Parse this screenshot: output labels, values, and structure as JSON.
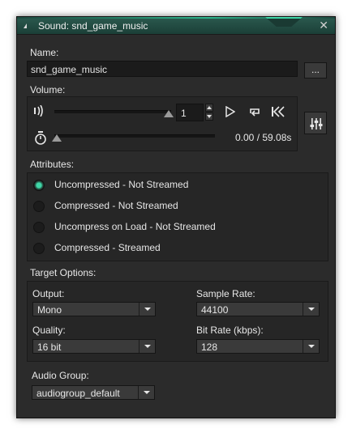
{
  "window": {
    "title": "Sound: snd_game_music",
    "close_glyph": "✕",
    "accent_color": "#3fd6a7"
  },
  "name": {
    "label": "Name:",
    "value": "snd_game_music",
    "browse_label": "..."
  },
  "volume": {
    "label": "Volume:",
    "value": "1",
    "level": 1.0,
    "time_readout": "0.00 / 59.08s",
    "icons": [
      "volume-icon",
      "play-icon",
      "loop-icon",
      "rewind-icon",
      "stopwatch-icon",
      "mixer-icon"
    ]
  },
  "attributes": {
    "label": "Attributes:",
    "options": [
      {
        "label": "Uncompressed - Not Streamed",
        "checked": true
      },
      {
        "label": "Compressed - Not Streamed",
        "checked": false
      },
      {
        "label": "Uncompress on Load - Not Streamed",
        "checked": false
      },
      {
        "label": "Compressed - Streamed",
        "checked": false
      }
    ]
  },
  "target": {
    "label": "Target Options:",
    "output_label": "Output:",
    "output_value": "Mono",
    "sample_rate_label": "Sample Rate:",
    "sample_rate_value": "44100",
    "quality_label": "Quality:",
    "quality_value": "16 bit",
    "bitrate_label": "Bit Rate (kbps):",
    "bitrate_value": "128"
  },
  "audio_group": {
    "label": "Audio Group:",
    "value": "audiogroup_default"
  }
}
